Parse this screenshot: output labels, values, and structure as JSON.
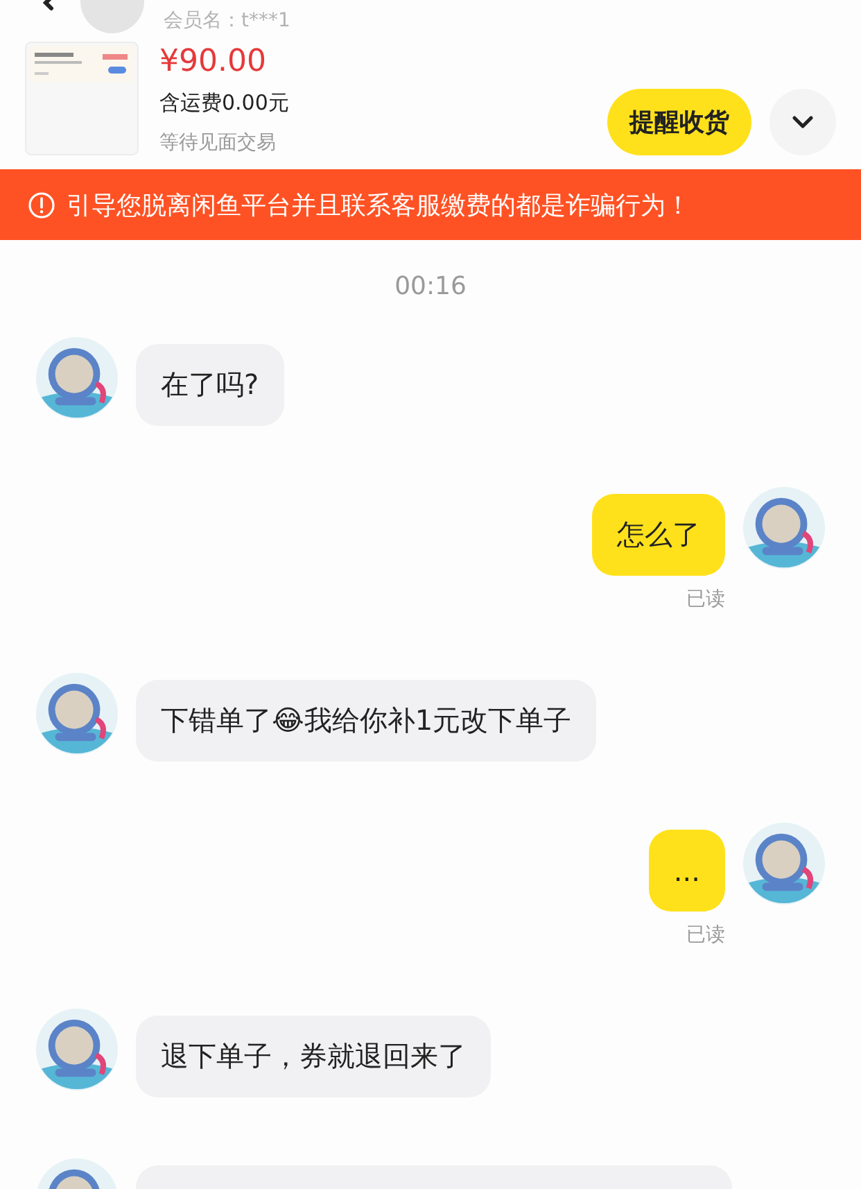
{
  "header": {
    "member_name": "会员名：t***1"
  },
  "order": {
    "price": "¥90.00",
    "shipping": "含运费0.00元",
    "status": "等待见面交易",
    "action": "提醒收货"
  },
  "warning": {
    "text": "引导您脱离闲鱼平台并且联系客服缴费的都是诈骗行为！"
  },
  "timestamp": "00:16",
  "messages": [
    {
      "kind": "incoming",
      "text": "在了吗?"
    },
    {
      "kind": "outgoing",
      "text": "怎么了",
      "read": "已读"
    },
    {
      "kind": "incoming",
      "text": "下错单了😂我给你补1元改下单子"
    },
    {
      "kind": "outgoing",
      "text": "...",
      "read": "已读"
    },
    {
      "kind": "incoming",
      "text": "退下单子，券就退回来了"
    },
    {
      "kind": "incoming"
    }
  ]
}
